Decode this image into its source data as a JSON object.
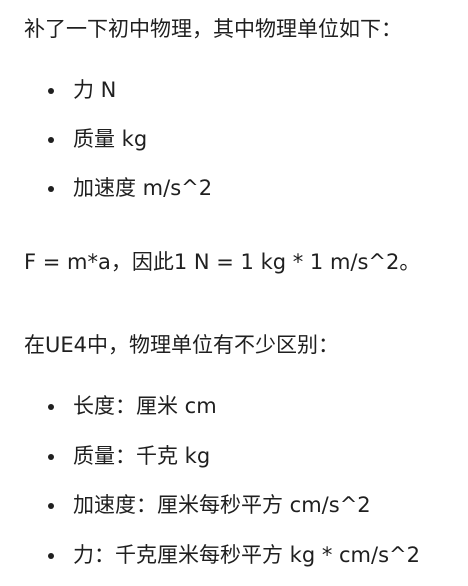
{
  "intro": "补了一下初中物理，其中物理单位如下：",
  "physics_units": [
    "力 N",
    "质量 kg",
    "加速度 m/s^2"
  ],
  "formula": "F = m*a，因此1 N = 1 kg * 1 m/s^2。",
  "ue4_intro": "在UE4中，物理单位有不少区别：",
  "ue4_units": [
    "长度：厘米 cm",
    "质量：千克 kg",
    "加速度：厘米每秒平方 cm/s^2",
    "力：千克厘米每秒平方 kg * cm/s^2"
  ],
  "colors": {
    "text": "#1f1f1f",
    "background": "#ffffff"
  }
}
